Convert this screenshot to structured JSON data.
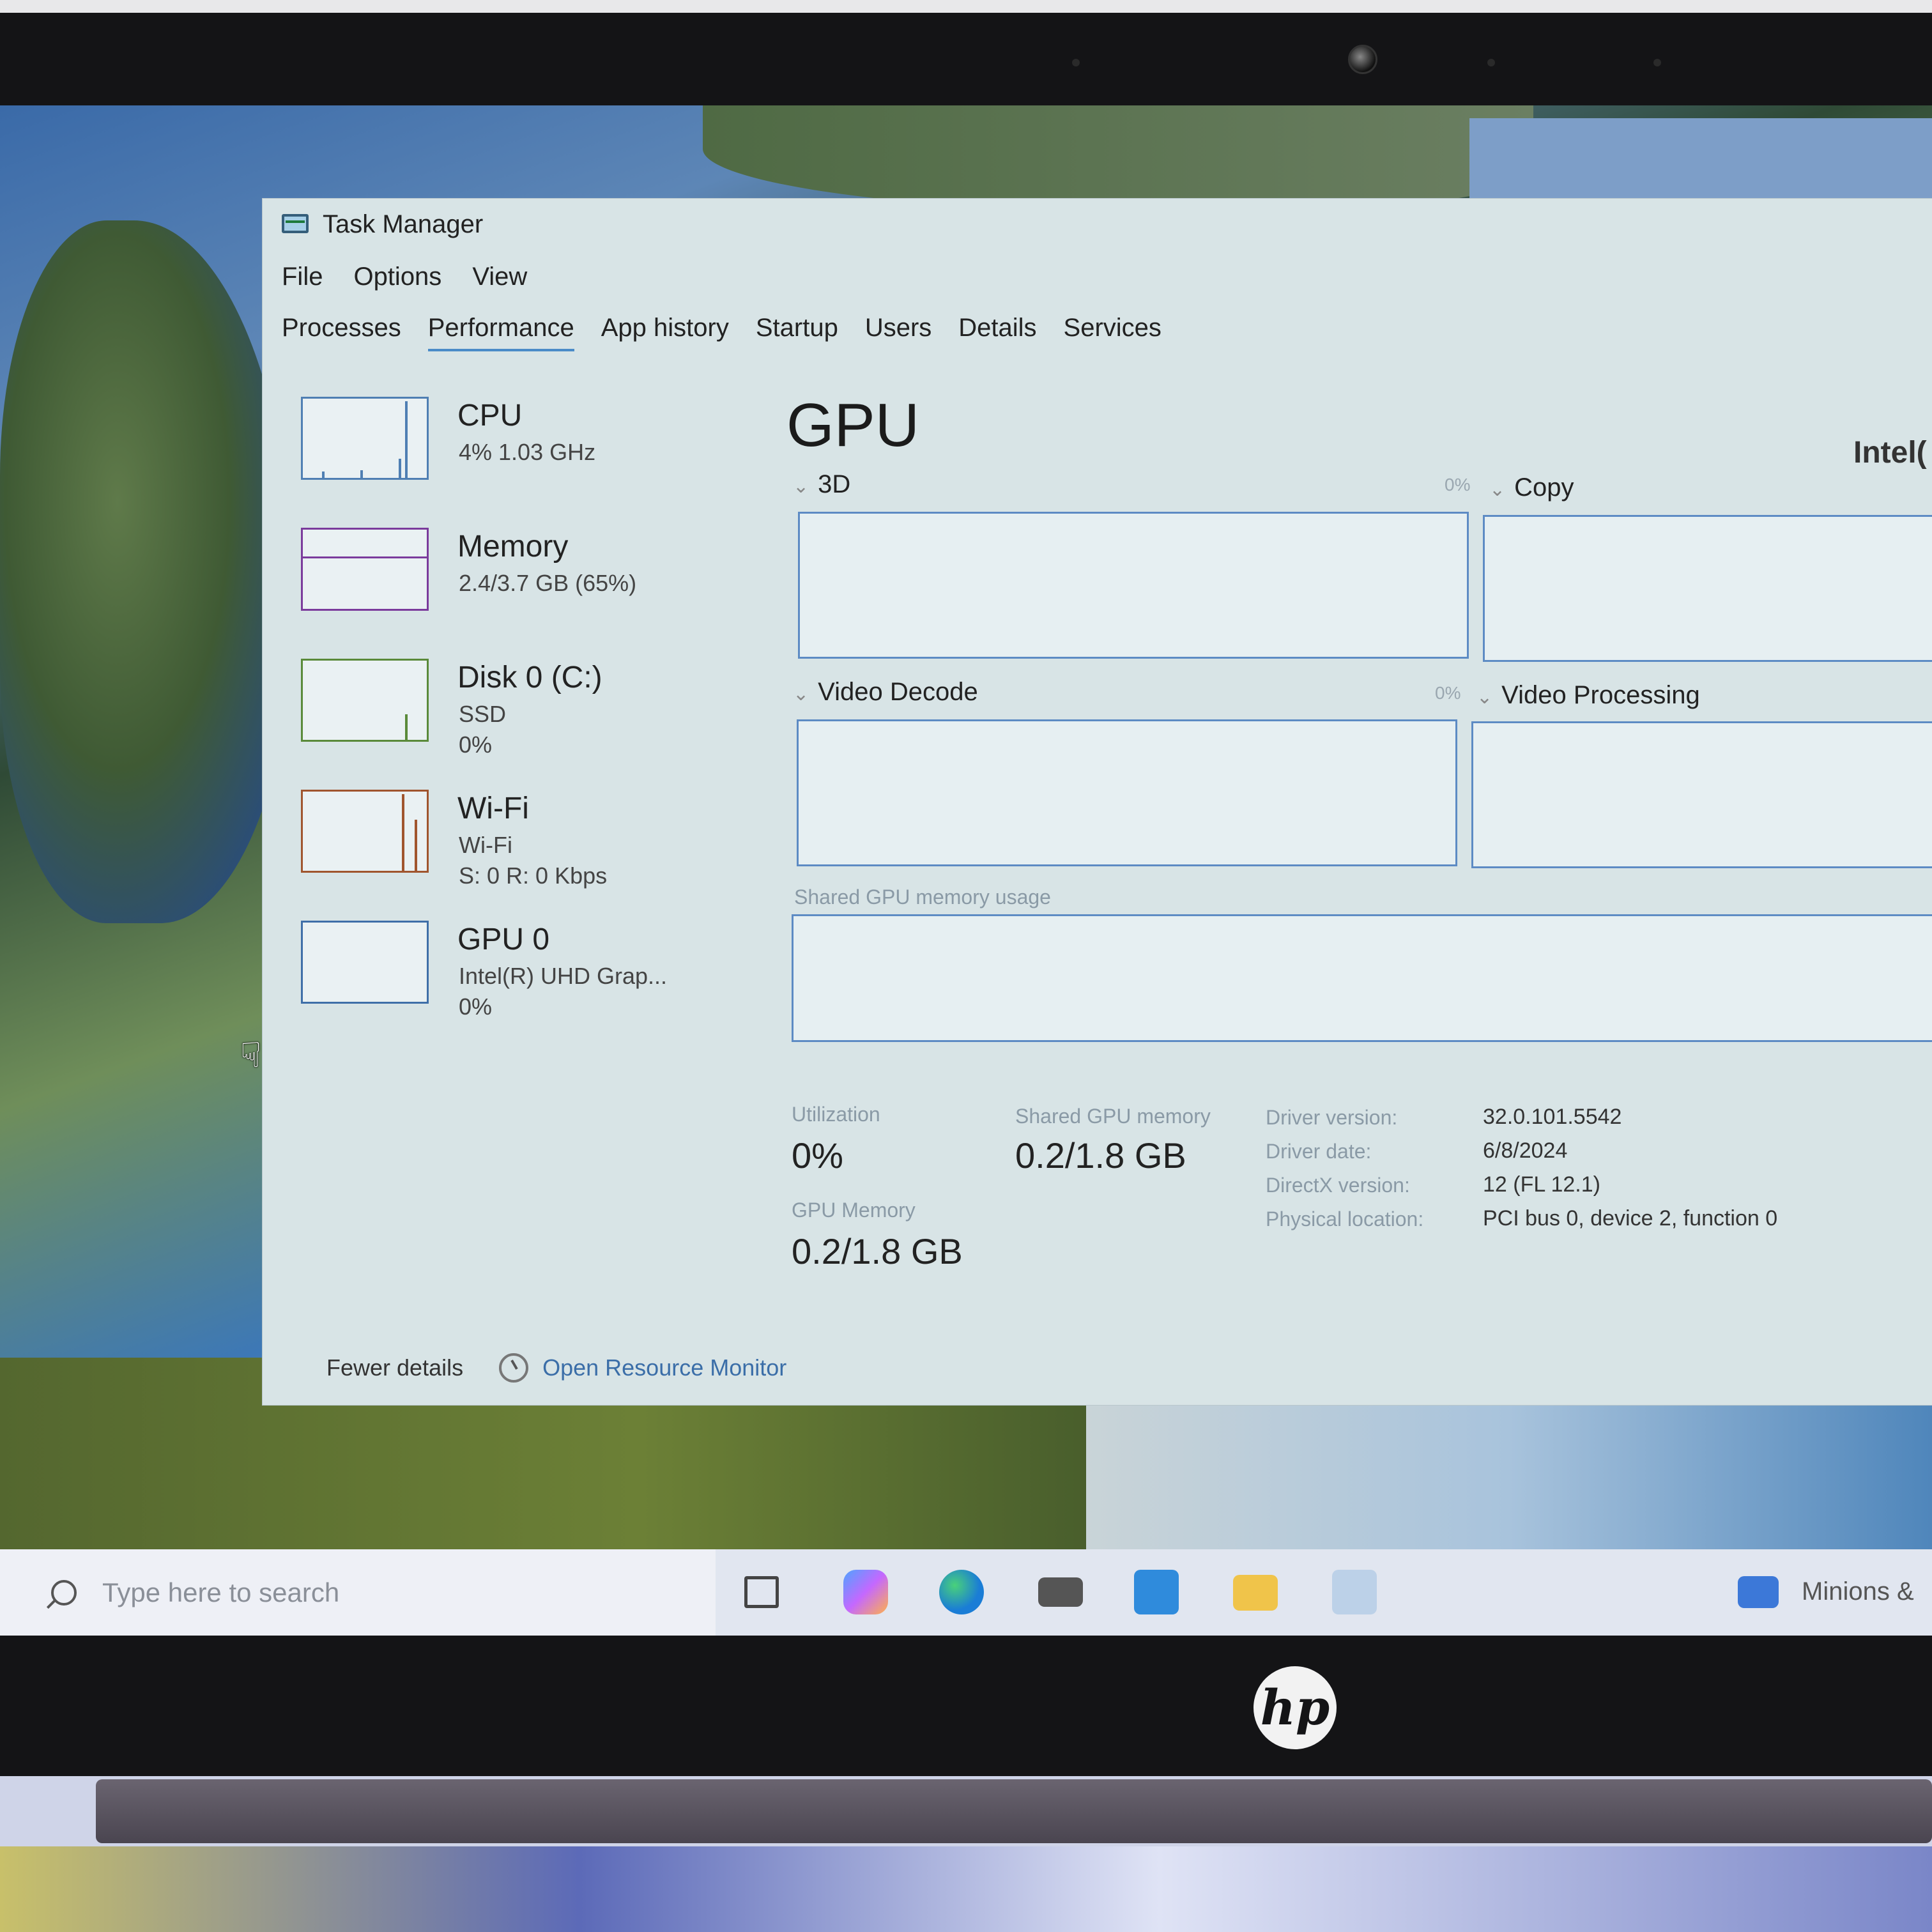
{
  "window": {
    "title": "Task Manager"
  },
  "menu": [
    "File",
    "Options",
    "View"
  ],
  "tabs": [
    "Processes",
    "Performance",
    "App history",
    "Startup",
    "Users",
    "Details",
    "Services"
  ],
  "active_tab": "Performance",
  "resources": [
    {
      "name": "CPU",
      "sub1": "4% 1.03 GHz",
      "sub2": ""
    },
    {
      "name": "Memory",
      "sub1": "2.4/3.7 GB (65%)",
      "sub2": ""
    },
    {
      "name": "Disk 0 (C:)",
      "sub1": "SSD",
      "sub2": "0%"
    },
    {
      "name": "Wi-Fi",
      "sub1": "Wi-Fi",
      "sub2": "S: 0 R: 0 Kbps"
    },
    {
      "name": "GPU 0",
      "sub1": "Intel(R) UHD Grap...",
      "sub2": "0%"
    }
  ],
  "gpu_panel": {
    "title": "GPU",
    "model": "Intel(",
    "engines": [
      {
        "label": "3D",
        "pct": "0%"
      },
      {
        "label": "Copy",
        "pct": ""
      },
      {
        "label": "Video Decode",
        "pct": "0%"
      },
      {
        "label": "Video Processing",
        "pct": ""
      }
    ],
    "shared_label": "Shared GPU memory usage",
    "stats": {
      "utilization_label": "Utilization",
      "utilization_value": "0%",
      "shared_mem_label": "Shared GPU memory",
      "shared_mem_value": "0.2/1.8 GB",
      "gpu_mem_label": "GPU Memory",
      "gpu_mem_value": "0.2/1.8 GB"
    },
    "info": [
      {
        "key": "Driver version:",
        "value": "32.0.101.5542"
      },
      {
        "key": "Driver date:",
        "value": "6/8/2024"
      },
      {
        "key": "DirectX version:",
        "value": "12 (FL 12.1)"
      },
      {
        "key": "Physical location:",
        "value": "PCI bus 0, device 2, function 0"
      }
    ]
  },
  "footer": {
    "fewer_details": "Fewer details",
    "open_resource_monitor": "Open Resource Monitor"
  },
  "taskbar": {
    "search_placeholder": "Type here to search",
    "media_text": "Minions &"
  },
  "brand": {
    "logo_text": "hp"
  },
  "colors": {
    "window_bg": "#d8e4e6",
    "accent": "#4a8bc8",
    "graph_border": "#5d8bc4"
  }
}
